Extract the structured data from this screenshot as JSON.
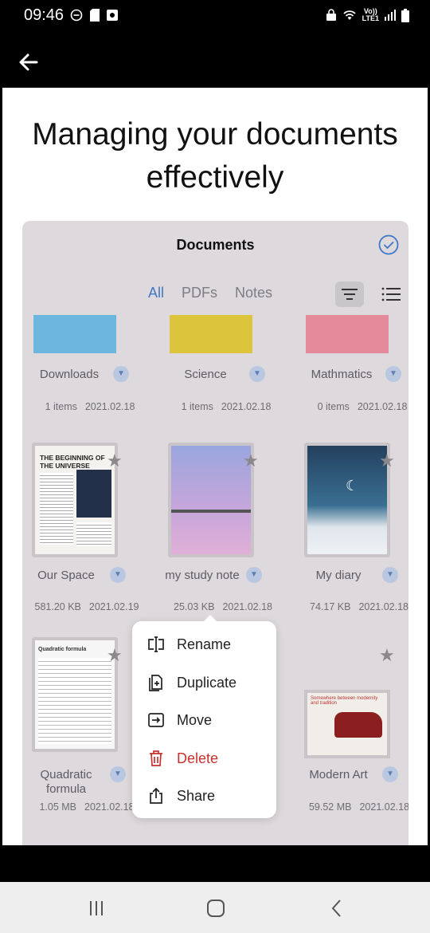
{
  "status": {
    "time": "09:46",
    "lte_top": "Vo))",
    "lte_bottom": "LTE1"
  },
  "headline": [
    "Managing your documents",
    "effectively"
  ],
  "panel": {
    "title": "Documents",
    "tabs": [
      "All",
      "PDFs",
      "Notes"
    ]
  },
  "folders": [
    {
      "name": "Downloads",
      "count": "1 items",
      "date": "2021.02.18",
      "color": "#6db7de"
    },
    {
      "name": "Science",
      "count": "1 items",
      "date": "2021.02.18",
      "color": "#dcc43c"
    },
    {
      "name": "Mathmatics",
      "count": "0 items",
      "date": "2021.02.18",
      "color": "#e58a9a"
    }
  ],
  "files_row1": [
    {
      "name": "Our Space",
      "size": "581.20 KB",
      "date": "2021.02.19",
      "thumb_title": "THE BEGINNING OF THE UNIVERSE"
    },
    {
      "name": "my study note",
      "size": "25.03 KB",
      "date": "2021.02.18"
    },
    {
      "name": "My diary",
      "size": "74.17 KB",
      "date": "2021.02.18"
    }
  ],
  "files_row2": [
    {
      "name_line1": "Quadratic",
      "name_line2": "formula",
      "size": "1.05 MB",
      "date": "2021.02.18",
      "thumb_title": "Quadratic formula"
    },
    {
      "name": "Modern Art",
      "size": "59.52 MB",
      "date": "2021.02.18",
      "thumb_title": "Somewhere between modernity and tradition"
    }
  ],
  "context_menu": {
    "rename": "Rename",
    "duplicate": "Duplicate",
    "move": "Move",
    "delete": "Delete",
    "share": "Share"
  },
  "colors": {
    "accent": "#4077c6",
    "delete": "#c8312f",
    "panel": "#ddd9dd"
  }
}
